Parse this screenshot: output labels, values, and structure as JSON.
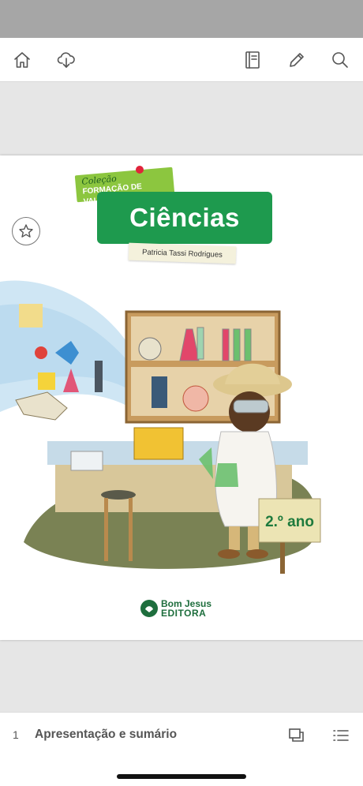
{
  "toolbar": {
    "icons": [
      "home-icon",
      "cloud-download-icon",
      "notebook-icon",
      "pencil-icon",
      "search-icon"
    ]
  },
  "cover": {
    "series_prefix": "Coleção",
    "series_name": "FORMAÇÃO DE VALOR",
    "title": "Ciências",
    "author": "Patricia Tassi Rodrigues",
    "grade": "2.º ano",
    "publisher_line1": "Bom Jesus",
    "publisher_line2": "EDITORA",
    "accent_green": "#1e9a4e",
    "tag_green": "#8cc63f"
  },
  "bottom_bar": {
    "page_number": "1",
    "section_title": "Apresentação e sumário",
    "icons": [
      "pages-icon",
      "list-icon"
    ]
  }
}
